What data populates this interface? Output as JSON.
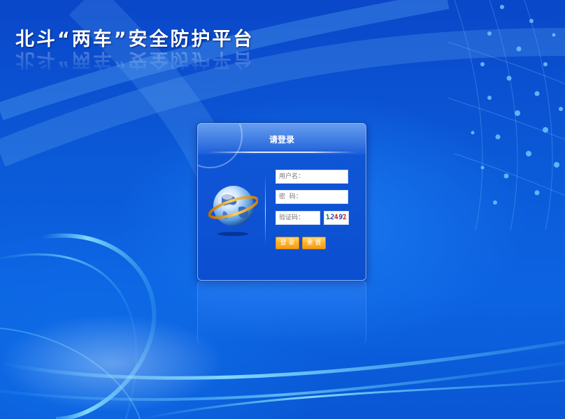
{
  "app": {
    "title": "北斗“两车”安全防护平台"
  },
  "login_panel": {
    "heading": "请登录",
    "username": {
      "placeholder": "用户名：",
      "value": ""
    },
    "password": {
      "placeholder": "密  码：",
      "value": ""
    },
    "captcha_field": {
      "placeholder": "验证码：",
      "value": ""
    },
    "captcha_image": {
      "digits": [
        "1",
        "2",
        "4",
        "9",
        "2"
      ],
      "colors": [
        "#1a7a3a",
        "#2040c0",
        "#c02020",
        "#2040c0",
        "#c02020"
      ]
    },
    "login_button_label": "登 录",
    "reset_button_label": "重 置"
  },
  "colors": {
    "background": "#0b5ad8",
    "panel": "#0f56d6",
    "button": "#ffb02a",
    "text_light": "#ffffff"
  },
  "icons": {
    "logo": "globe-icon"
  }
}
